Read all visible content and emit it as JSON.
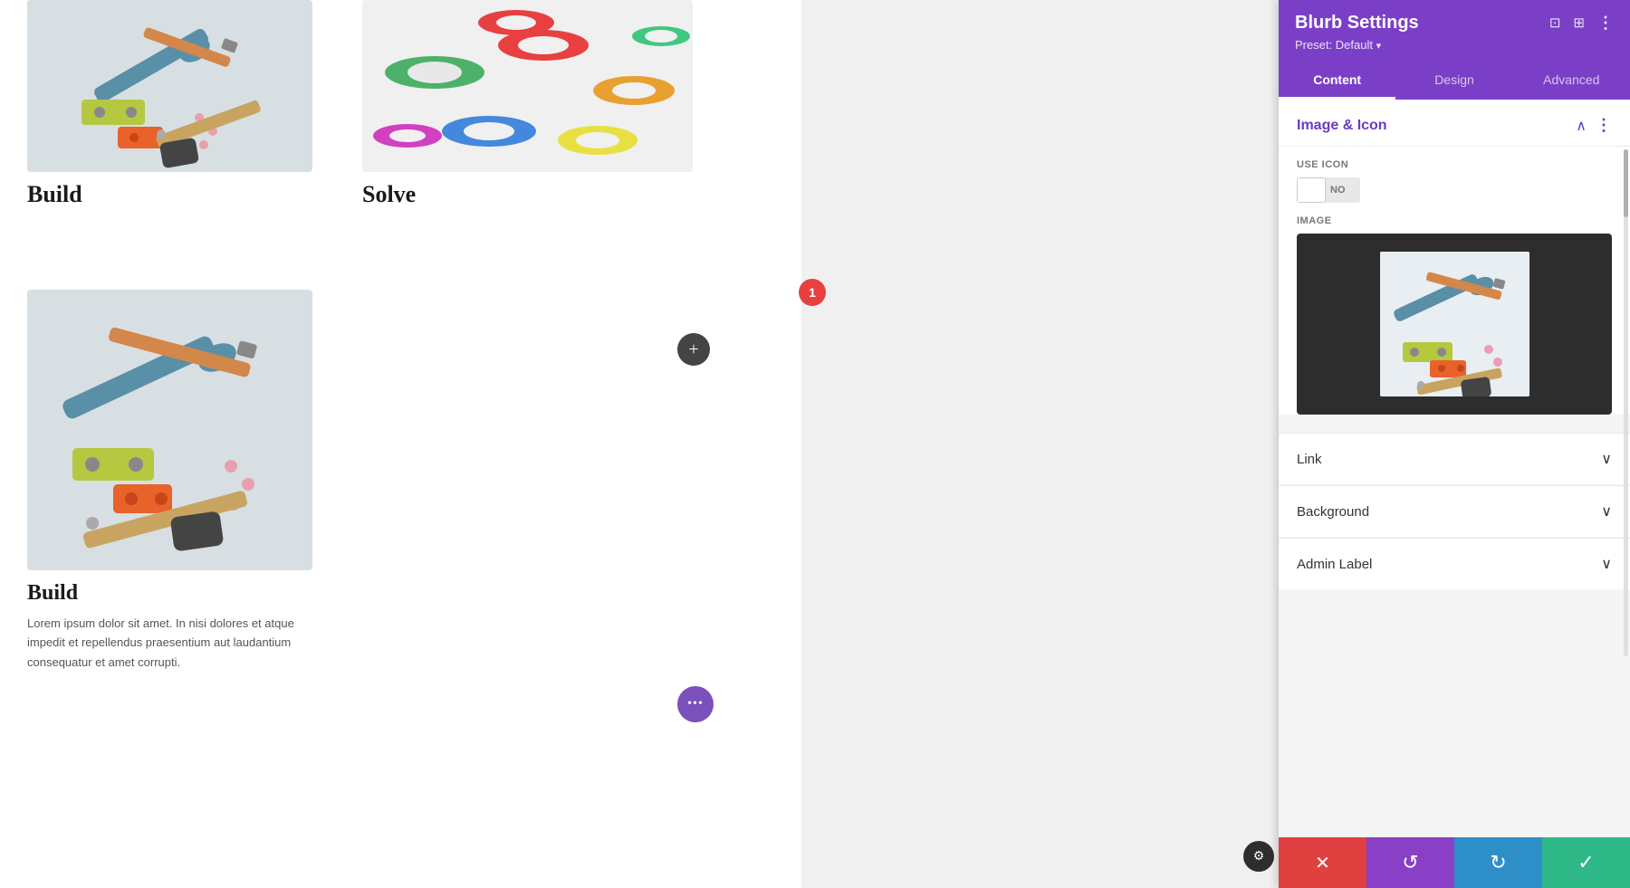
{
  "panel": {
    "title": "Blurb Settings",
    "preset_label": "Preset: Default",
    "preset_arrow": "▾",
    "tabs": [
      {
        "id": "content",
        "label": "Content",
        "active": true
      },
      {
        "id": "design",
        "label": "Design",
        "active": false
      },
      {
        "id": "advanced",
        "label": "Advanced",
        "active": false
      }
    ],
    "section_image_icon": {
      "title": "Image & Icon"
    },
    "use_icon_label": "Use Icon",
    "toggle_label": "NO",
    "image_label": "Image",
    "link_section": "Link",
    "background_section": "Background",
    "admin_label_section": "Admin Label",
    "actions": {
      "cancel": "✕",
      "undo": "↺",
      "redo": "↻",
      "confirm": "✓"
    }
  },
  "blurbs": [
    {
      "id": "build-top",
      "title": "Build",
      "text": ""
    },
    {
      "id": "solve-top",
      "title": "Solve",
      "text": ""
    },
    {
      "id": "build-bottom",
      "title": "Build",
      "text": "Lorem ipsum dolor sit amet. In nisi dolores et atque impedit et repellendus praesentium aut laudantium consequatur et amet corrupti."
    }
  ],
  "badge": "1",
  "plus_btn": "+",
  "dots_btn": "•••"
}
